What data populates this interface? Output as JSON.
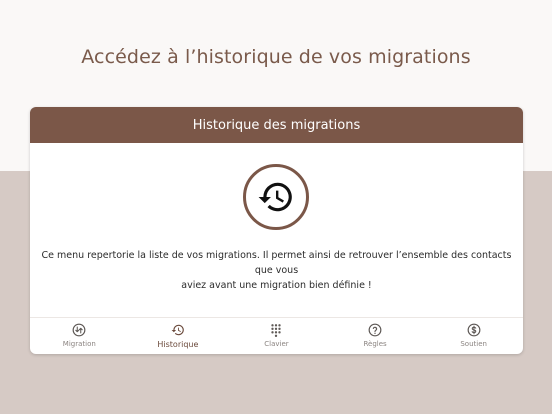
{
  "headline": "Accédez à l’historique de vos migrations",
  "card": {
    "title": "Historique des migrations",
    "icon": "history-icon",
    "description_line1": "Ce menu repertorie la liste de vos migrations. Il permet ainsi de retrouver l’ensemble des contacts que vous",
    "description_line2": "aviez avant une migration bien définie !"
  },
  "tabs": [
    {
      "label": "Migration",
      "icon": "migration-icon",
      "active": false
    },
    {
      "label": "Historique",
      "icon": "history-icon",
      "active": true
    },
    {
      "label": "Clavier",
      "icon": "keypad-icon",
      "active": false
    },
    {
      "label": "Règles",
      "icon": "help-icon",
      "active": false
    },
    {
      "label": "Soutien",
      "icon": "dollar-icon",
      "active": false
    }
  ],
  "colors": {
    "accent": "#7b5748",
    "headline": "#7a5a4b",
    "band": "#d6cac5",
    "inactive_tab": "#8b8481"
  }
}
